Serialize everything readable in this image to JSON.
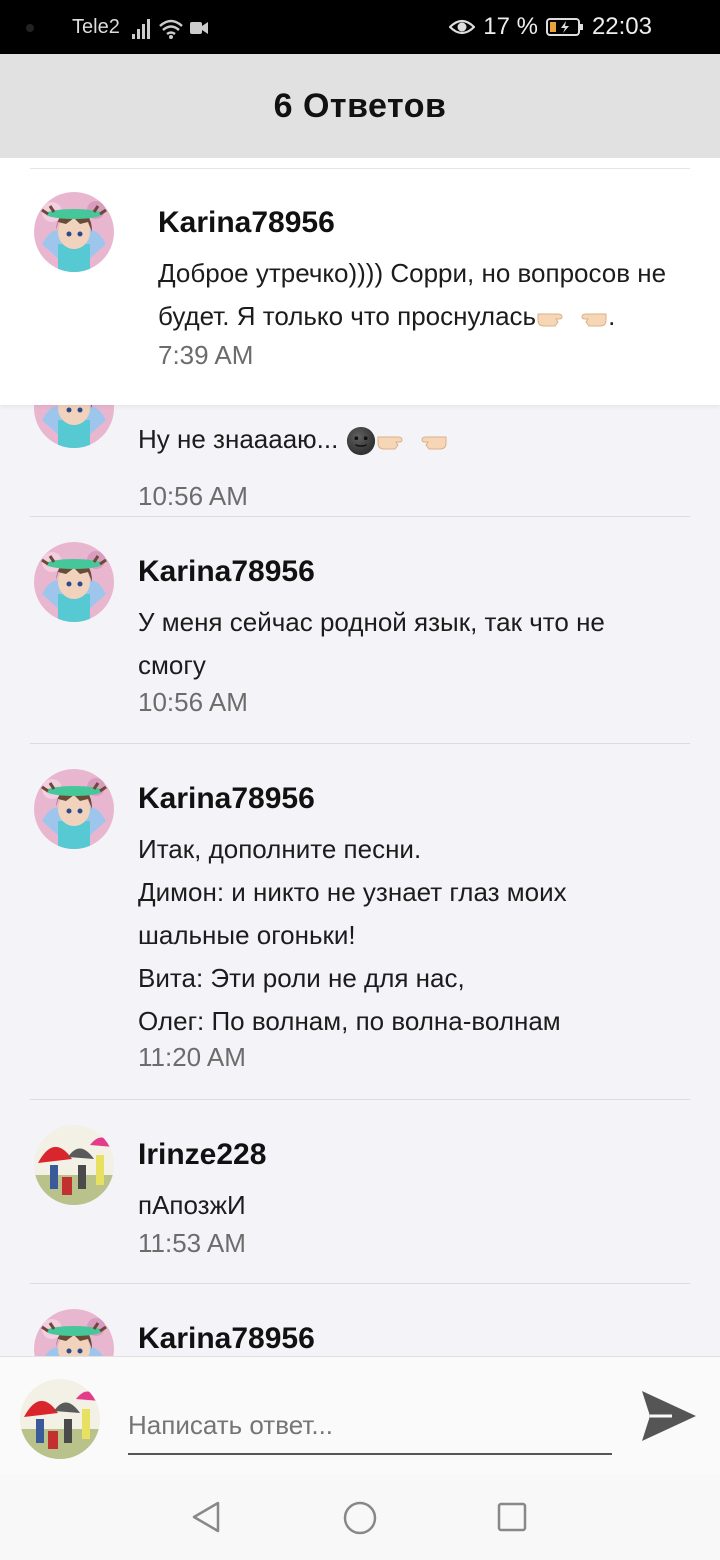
{
  "status_bar": {
    "carrier": "Tele2",
    "battery": "17 %",
    "time": "22:03"
  },
  "header": {
    "title": "6 Ответов"
  },
  "original_post": {
    "username": "Karina78956",
    "text": "Доброе утречко)))) Сорри, но вопросов не будет. Я только что проснулась",
    "text_end": ".",
    "time": "7:39 AM"
  },
  "replies": [
    {
      "username": "",
      "text": "Ну не знааааю...",
      "time": "10:56 AM",
      "avatar": "gacha-avatar"
    },
    {
      "username": "Karina78956",
      "lines": [
        "У меня сейчас родной язык, так что не смогу"
      ],
      "time": "10:56 AM",
      "avatar": "gacha-avatar"
    },
    {
      "username": "Karina78956",
      "lines": [
        "Итак, дополните песни.",
        "Димон: и никто не узнает глаз моих шальные огоньки!",
        "Вита: Эти роли не для нас,",
        "Олег: По волнам, по волна-волнам"
      ],
      "time": "11:20 AM",
      "avatar": "gacha-avatar"
    },
    {
      "username": "Irinze228",
      "lines": [
        "пАпозжИ"
      ],
      "time": "11:53 AM",
      "avatar": "umbrella-avatar"
    },
    {
      "username": "Karina78956",
      "lines": [],
      "time": "",
      "avatar": "gacha-avatar"
    }
  ],
  "composer": {
    "placeholder": "Написать ответ...",
    "avatar": "umbrella-avatar",
    "send_icon": "send-icon"
  },
  "navbar": {
    "back_icon": "back-triangle-icon",
    "home_icon": "home-circle-icon",
    "recents_icon": "recents-square-icon"
  },
  "colors": {
    "header_bg": "#e1e1e1",
    "list_bg": "#f4f4f8",
    "status_bg": "#000000"
  }
}
